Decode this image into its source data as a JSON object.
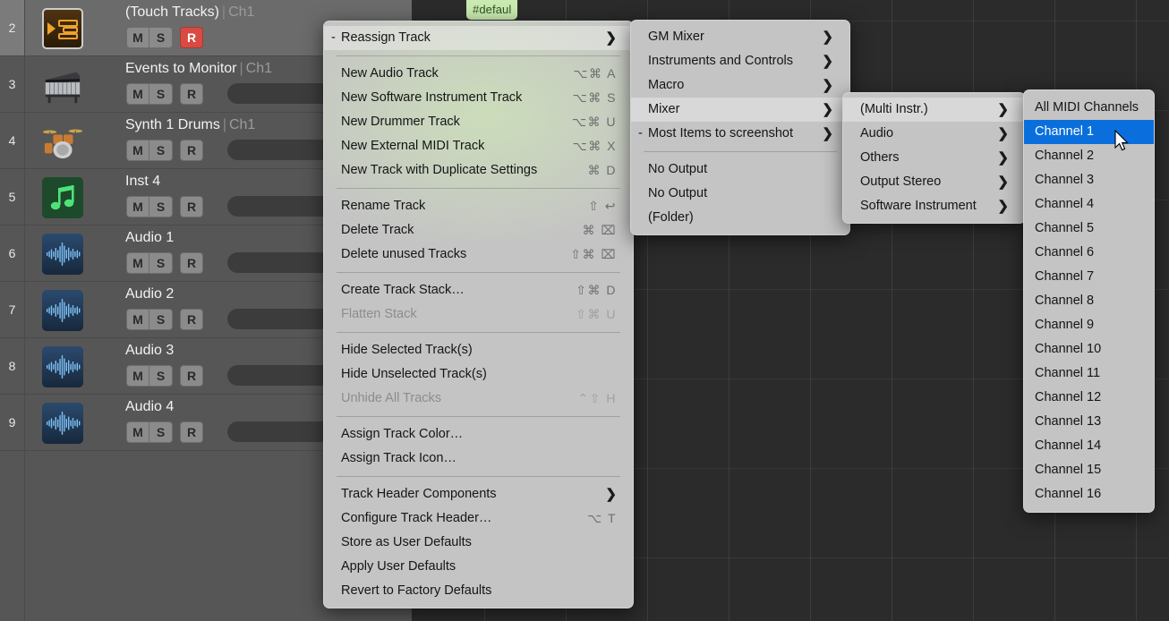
{
  "arrangement": {
    "ruler_tag": "#defaul"
  },
  "tracks": [
    {
      "number": "2",
      "name": "(Touch Tracks)",
      "separator": "|",
      "channel": "Ch1",
      "icon": "touch-tracks-icon",
      "selected": true,
      "mute_label": "M",
      "solo_label": "S",
      "record_label": "R",
      "record_armed": true,
      "has_volume": false
    },
    {
      "number": "3",
      "name": "Events to Monitor",
      "separator": "|",
      "channel": "Ch1",
      "icon": "piano-icon",
      "selected": false,
      "mute_label": "M",
      "solo_label": "S",
      "record_label": "R",
      "record_armed": false,
      "has_volume": true
    },
    {
      "number": "4",
      "name": "Synth 1 Drums",
      "separator": "|",
      "channel": "Ch1",
      "icon": "drums-icon",
      "selected": false,
      "mute_label": "M",
      "solo_label": "S",
      "record_label": "R",
      "record_armed": false,
      "has_volume": true
    },
    {
      "number": "5",
      "name": "Inst 4",
      "separator": "",
      "channel": "",
      "icon": "music-note-icon",
      "selected": false,
      "mute_label": "M",
      "solo_label": "S",
      "record_label": "R",
      "record_armed": false,
      "has_volume": true
    },
    {
      "number": "6",
      "name": "Audio 1",
      "separator": "",
      "channel": "",
      "icon": "waveform-icon",
      "selected": false,
      "mute_label": "M",
      "solo_label": "S",
      "record_label": "R",
      "record_armed": false,
      "has_volume": true
    },
    {
      "number": "7",
      "name": "Audio 2",
      "separator": "",
      "channel": "",
      "icon": "waveform-icon",
      "selected": false,
      "mute_label": "M",
      "solo_label": "S",
      "record_label": "R",
      "record_armed": false,
      "has_volume": true
    },
    {
      "number": "8",
      "name": "Audio 3",
      "separator": "",
      "channel": "",
      "icon": "waveform-icon",
      "selected": false,
      "mute_label": "M",
      "solo_label": "S",
      "record_label": "R",
      "record_armed": false,
      "has_volume": true
    },
    {
      "number": "9",
      "name": "Audio 4",
      "separator": "",
      "channel": "",
      "icon": "waveform-icon",
      "selected": false,
      "mute_label": "M",
      "solo_label": "S",
      "record_label": "R",
      "record_armed": false,
      "has_volume": true
    }
  ],
  "context_menu": {
    "items": [
      {
        "label": "Reassign Track",
        "shortcut": "",
        "submenu": true,
        "dash": true,
        "highlighted": true
      },
      {
        "separator": true
      },
      {
        "label": "New Audio Track",
        "shortcut": "⌥⌘ A"
      },
      {
        "label": "New Software Instrument Track",
        "shortcut": "⌥⌘ S"
      },
      {
        "label": "New Drummer Track",
        "shortcut": "⌥⌘ U"
      },
      {
        "label": "New External MIDI Track",
        "shortcut": "⌥⌘ X"
      },
      {
        "label": "New Track with Duplicate Settings",
        "shortcut": "⌘ D"
      },
      {
        "separator": true
      },
      {
        "label": "Rename Track",
        "shortcut": "⇧ ↩"
      },
      {
        "label": "Delete Track",
        "shortcut": "⌘ ⌧"
      },
      {
        "label": "Delete unused Tracks",
        "shortcut": "⇧⌘ ⌧"
      },
      {
        "separator": true
      },
      {
        "label": "Create Track Stack…",
        "shortcut": "⇧⌘ D"
      },
      {
        "label": "Flatten Stack",
        "shortcut": "⇧⌘ U",
        "disabled": true
      },
      {
        "separator": true
      },
      {
        "label": "Hide Selected Track(s)",
        "shortcut": ""
      },
      {
        "label": "Hide Unselected Track(s)",
        "shortcut": ""
      },
      {
        "label": "Unhide All Tracks",
        "shortcut": "⌃⇧ H",
        "disabled": true
      },
      {
        "separator": true
      },
      {
        "label": "Assign Track Color…",
        "shortcut": ""
      },
      {
        "label": "Assign Track Icon…",
        "shortcut": ""
      },
      {
        "separator": true
      },
      {
        "label": "Track Header Components",
        "shortcut": "",
        "submenu": true
      },
      {
        "label": "Configure Track Header…",
        "shortcut": "⌥ T"
      },
      {
        "label": "Store as User Defaults",
        "shortcut": ""
      },
      {
        "label": "Apply User Defaults",
        "shortcut": ""
      },
      {
        "label": "Revert to Factory Defaults",
        "shortcut": ""
      }
    ]
  },
  "reassign_submenu": {
    "items": [
      {
        "label": "GM Mixer",
        "submenu": true
      },
      {
        "label": "Instruments and Controls",
        "submenu": true
      },
      {
        "label": "Macro",
        "submenu": true
      },
      {
        "label": "Mixer",
        "submenu": true,
        "highlighted": true
      },
      {
        "label": "Most Items to screenshot",
        "submenu": true,
        "dash": true
      },
      {
        "separator": true
      },
      {
        "label": "No Output"
      },
      {
        "label": "No Output"
      },
      {
        "label": "(Folder)"
      }
    ]
  },
  "mixer_submenu": {
    "items": [
      {
        "label": "(Multi Instr.)",
        "submenu": true,
        "highlighted": true
      },
      {
        "label": "Audio",
        "submenu": true
      },
      {
        "label": "Others",
        "submenu": true
      },
      {
        "label": "Output Stereo",
        "submenu": true
      },
      {
        "label": "Software Instrument",
        "submenu": true
      }
    ]
  },
  "midi_channel_submenu": {
    "items": [
      {
        "label": "All MIDI Channels"
      },
      {
        "label": "Channel  1",
        "selected": true
      },
      {
        "label": "Channel  2"
      },
      {
        "label": "Channel  3"
      },
      {
        "label": "Channel  4"
      },
      {
        "label": "Channel  5"
      },
      {
        "label": "Channel  6"
      },
      {
        "label": "Channel  7"
      },
      {
        "label": "Channel  8"
      },
      {
        "label": "Channel  9"
      },
      {
        "label": "Channel 10"
      },
      {
        "label": "Channel 11"
      },
      {
        "label": "Channel 12"
      },
      {
        "label": "Channel 13"
      },
      {
        "label": "Channel 14"
      },
      {
        "label": "Channel 15"
      },
      {
        "label": "Channel 16"
      }
    ]
  },
  "colors": {
    "menu_background": "#c4c4c4",
    "selection_blue": "#0a6fdd",
    "record_red": "#d84a43",
    "tag_green": "#c9eab0",
    "tracklist_background": "#565656",
    "arrangement_background": "#2b2b2b"
  }
}
